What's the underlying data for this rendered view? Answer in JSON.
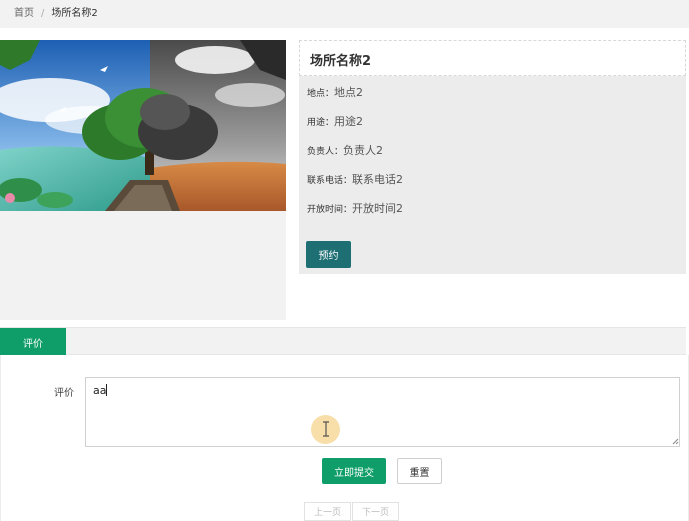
{
  "breadcrumb": {
    "home": "首页",
    "separator": "/",
    "current": "场所名称2"
  },
  "venue": {
    "name": "场所名称2",
    "fields": [
      {
        "label": "地点：",
        "value": "地点2"
      },
      {
        "label": "用途：",
        "value": "用途2"
      },
      {
        "label": "负责人：",
        "value": "负责人2"
      },
      {
        "label": "联系电话：",
        "value": "联系电话2"
      },
      {
        "label": "开放时间：",
        "value": "开放时间2"
      }
    ],
    "book_label": "预约"
  },
  "tabs": [
    {
      "label": "评价",
      "active": true
    }
  ],
  "review_form": {
    "label": "评价",
    "value": "aa",
    "submit_label": "立即提交",
    "reset_label": "重置"
  },
  "pagination": {
    "prev_label": "上一页",
    "next_label": "下一页"
  },
  "colors": {
    "primary_green": "#0f9e6a",
    "book_teal": "#1d6f74",
    "panel_gray": "#ececec"
  }
}
